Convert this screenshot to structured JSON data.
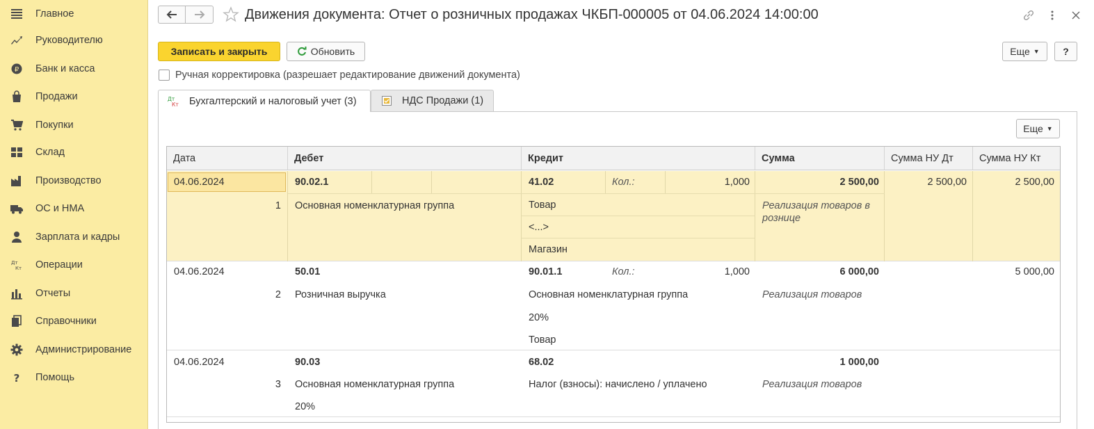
{
  "sidebar": {
    "items": [
      {
        "label": "Главное",
        "icon": "menu-icon"
      },
      {
        "label": "Руководителю",
        "icon": "trend-icon"
      },
      {
        "label": "Банк и касса",
        "icon": "coin-icon"
      },
      {
        "label": "Продажи",
        "icon": "bag-icon"
      },
      {
        "label": "Покупки",
        "icon": "cart-icon"
      },
      {
        "label": "Склад",
        "icon": "grid-icon"
      },
      {
        "label": "Производство",
        "icon": "factory-icon"
      },
      {
        "label": "ОС и НМА",
        "icon": "truck-icon"
      },
      {
        "label": "Зарплата и кадры",
        "icon": "person-icon"
      },
      {
        "label": "Операции",
        "icon": "dt-kt-icon"
      },
      {
        "label": "Отчеты",
        "icon": "bar-chart-icon"
      },
      {
        "label": "Справочники",
        "icon": "books-icon"
      },
      {
        "label": "Администрирование",
        "icon": "gear-icon"
      },
      {
        "label": "Помощь",
        "icon": "question-icon"
      }
    ]
  },
  "header": {
    "title": "Движения документа: Отчет о розничных продажах ЧКБП-000005 от 04.06.2024 14:00:00"
  },
  "toolbar": {
    "save_close": "Записать и закрыть",
    "refresh": "Обновить",
    "more": "Еще",
    "help": "?"
  },
  "manual_edit": {
    "label": "Ручная корректировка (разрешает редактирование движений документа)",
    "checked": false
  },
  "tabs": [
    {
      "label": "Бухгалтерский и налоговый учет (3)",
      "active": true
    },
    {
      "label": "НДС Продажи (1)",
      "active": false
    }
  ],
  "panel": {
    "more": "Еще"
  },
  "table": {
    "columns": [
      "Дата",
      "Дебет",
      "Кредит",
      "Сумма",
      "Сумма НУ Дт",
      "Сумма НУ Кт"
    ],
    "rows": [
      {
        "date": "04.06.2024",
        "num": "1",
        "debit": "90.02.1",
        "debit_sub": [
          "Основная номенклатурная группа"
        ],
        "credit": "41.02",
        "qty_label": "Кол.:",
        "qty": "1,000",
        "credit_sub": [
          "Товар",
          "<...>",
          "Магазин"
        ],
        "sum": "2 500,00",
        "sum_note": "Реализация товаров в рознице",
        "sum_nu_dt": "2 500,00",
        "sum_nu_kt": "2 500,00"
      },
      {
        "date": "04.06.2024",
        "num": "2",
        "debit": "50.01",
        "debit_sub": [
          "Розничная выручка"
        ],
        "credit": "90.01.1",
        "qty_label": "Кол.:",
        "qty": "1,000",
        "credit_sub": [
          "Основная номенклатурная группа",
          "20%",
          "Товар"
        ],
        "sum": "6 000,00",
        "sum_note": "Реализация товаров",
        "sum_nu_dt": "",
        "sum_nu_kt": "5 000,00"
      },
      {
        "date": "04.06.2024",
        "num": "3",
        "debit": "90.03",
        "debit_sub": [
          "Основная номенклатурная группа",
          "20%"
        ],
        "credit": "68.02",
        "qty_label": "",
        "qty": "",
        "credit_sub": [
          "Налог (взносы): начислено / уплачено"
        ],
        "sum": "1 000,00",
        "sum_note": "Реализация товаров",
        "sum_nu_dt": "",
        "sum_nu_kt": ""
      }
    ]
  }
}
